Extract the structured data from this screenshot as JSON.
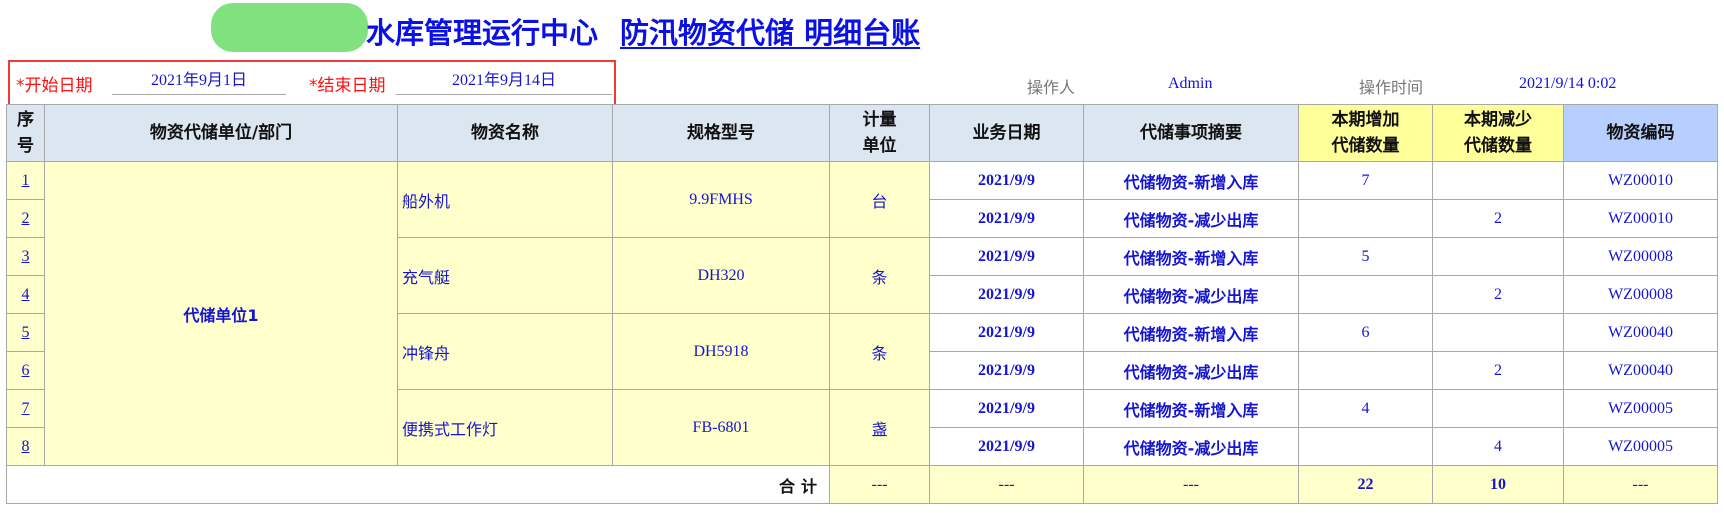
{
  "header": {
    "title_main": "水库管理运行中心",
    "title_sub": "防汛物资代储 明细台账",
    "redacted_prefix_color": "#80e27f"
  },
  "filters": {
    "start_label": "*开始日期",
    "start_value": "2021年9月1日",
    "end_label": "*结束日期",
    "end_value": "2021年9月14日"
  },
  "meta": {
    "operator_label": "操作人",
    "operator_value": "Admin",
    "time_label": "操作时间",
    "time_value": "2021/9/14 0:02"
  },
  "table": {
    "columns": {
      "seq": "序号",
      "unit": "物资代储单位/部门",
      "name": "物资名称",
      "spec": "规格型号",
      "measure": "计量单位",
      "date": "业务日期",
      "summary": "代储事项摘要",
      "increase": "本期增加代储数量",
      "decrease": "本期减少代储数量",
      "code": "物资编码"
    },
    "unit_group": "代储单位1",
    "items": [
      {
        "name": "船外机",
        "spec": "9.9FMHS",
        "measure": "台"
      },
      {
        "name": "充气艇",
        "spec": "DH320",
        "measure": "条"
      },
      {
        "name": "冲锋舟",
        "spec": "DH5918",
        "measure": "条"
      },
      {
        "name": "便携式工作灯",
        "spec": "FB-6801",
        "measure": "盏"
      }
    ],
    "rows": [
      {
        "seq": "1",
        "date": "2021/9/9",
        "summary": "代储物资-新增入库",
        "increase": "7",
        "decrease": "",
        "code": "WZ00010"
      },
      {
        "seq": "2",
        "date": "2021/9/9",
        "summary": "代储物资-减少出库",
        "increase": "",
        "decrease": "2",
        "code": "WZ00010"
      },
      {
        "seq": "3",
        "date": "2021/9/9",
        "summary": "代储物资-新增入库",
        "increase": "5",
        "decrease": "",
        "code": "WZ00008"
      },
      {
        "seq": "4",
        "date": "2021/9/9",
        "summary": "代储物资-减少出库",
        "increase": "",
        "decrease": "2",
        "code": "WZ00008"
      },
      {
        "seq": "5",
        "date": "2021/9/9",
        "summary": "代储物资-新增入库",
        "increase": "6",
        "decrease": "",
        "code": "WZ00040"
      },
      {
        "seq": "6",
        "date": "2021/9/9",
        "summary": "代储物资-减少出库",
        "increase": "",
        "decrease": "2",
        "code": "WZ00040"
      },
      {
        "seq": "7",
        "date": "2021/9/9",
        "summary": "代储物资-新增入库",
        "increase": "4",
        "decrease": "",
        "code": "WZ00005"
      },
      {
        "seq": "8",
        "date": "2021/9/9",
        "summary": "代储物资-减少出库",
        "increase": "",
        "decrease": "4",
        "code": "WZ00005"
      }
    ],
    "total": {
      "label": "合计",
      "measure": "---",
      "date": "---",
      "summary": "---",
      "increase": "22",
      "decrease": "10",
      "code": "---"
    }
  }
}
